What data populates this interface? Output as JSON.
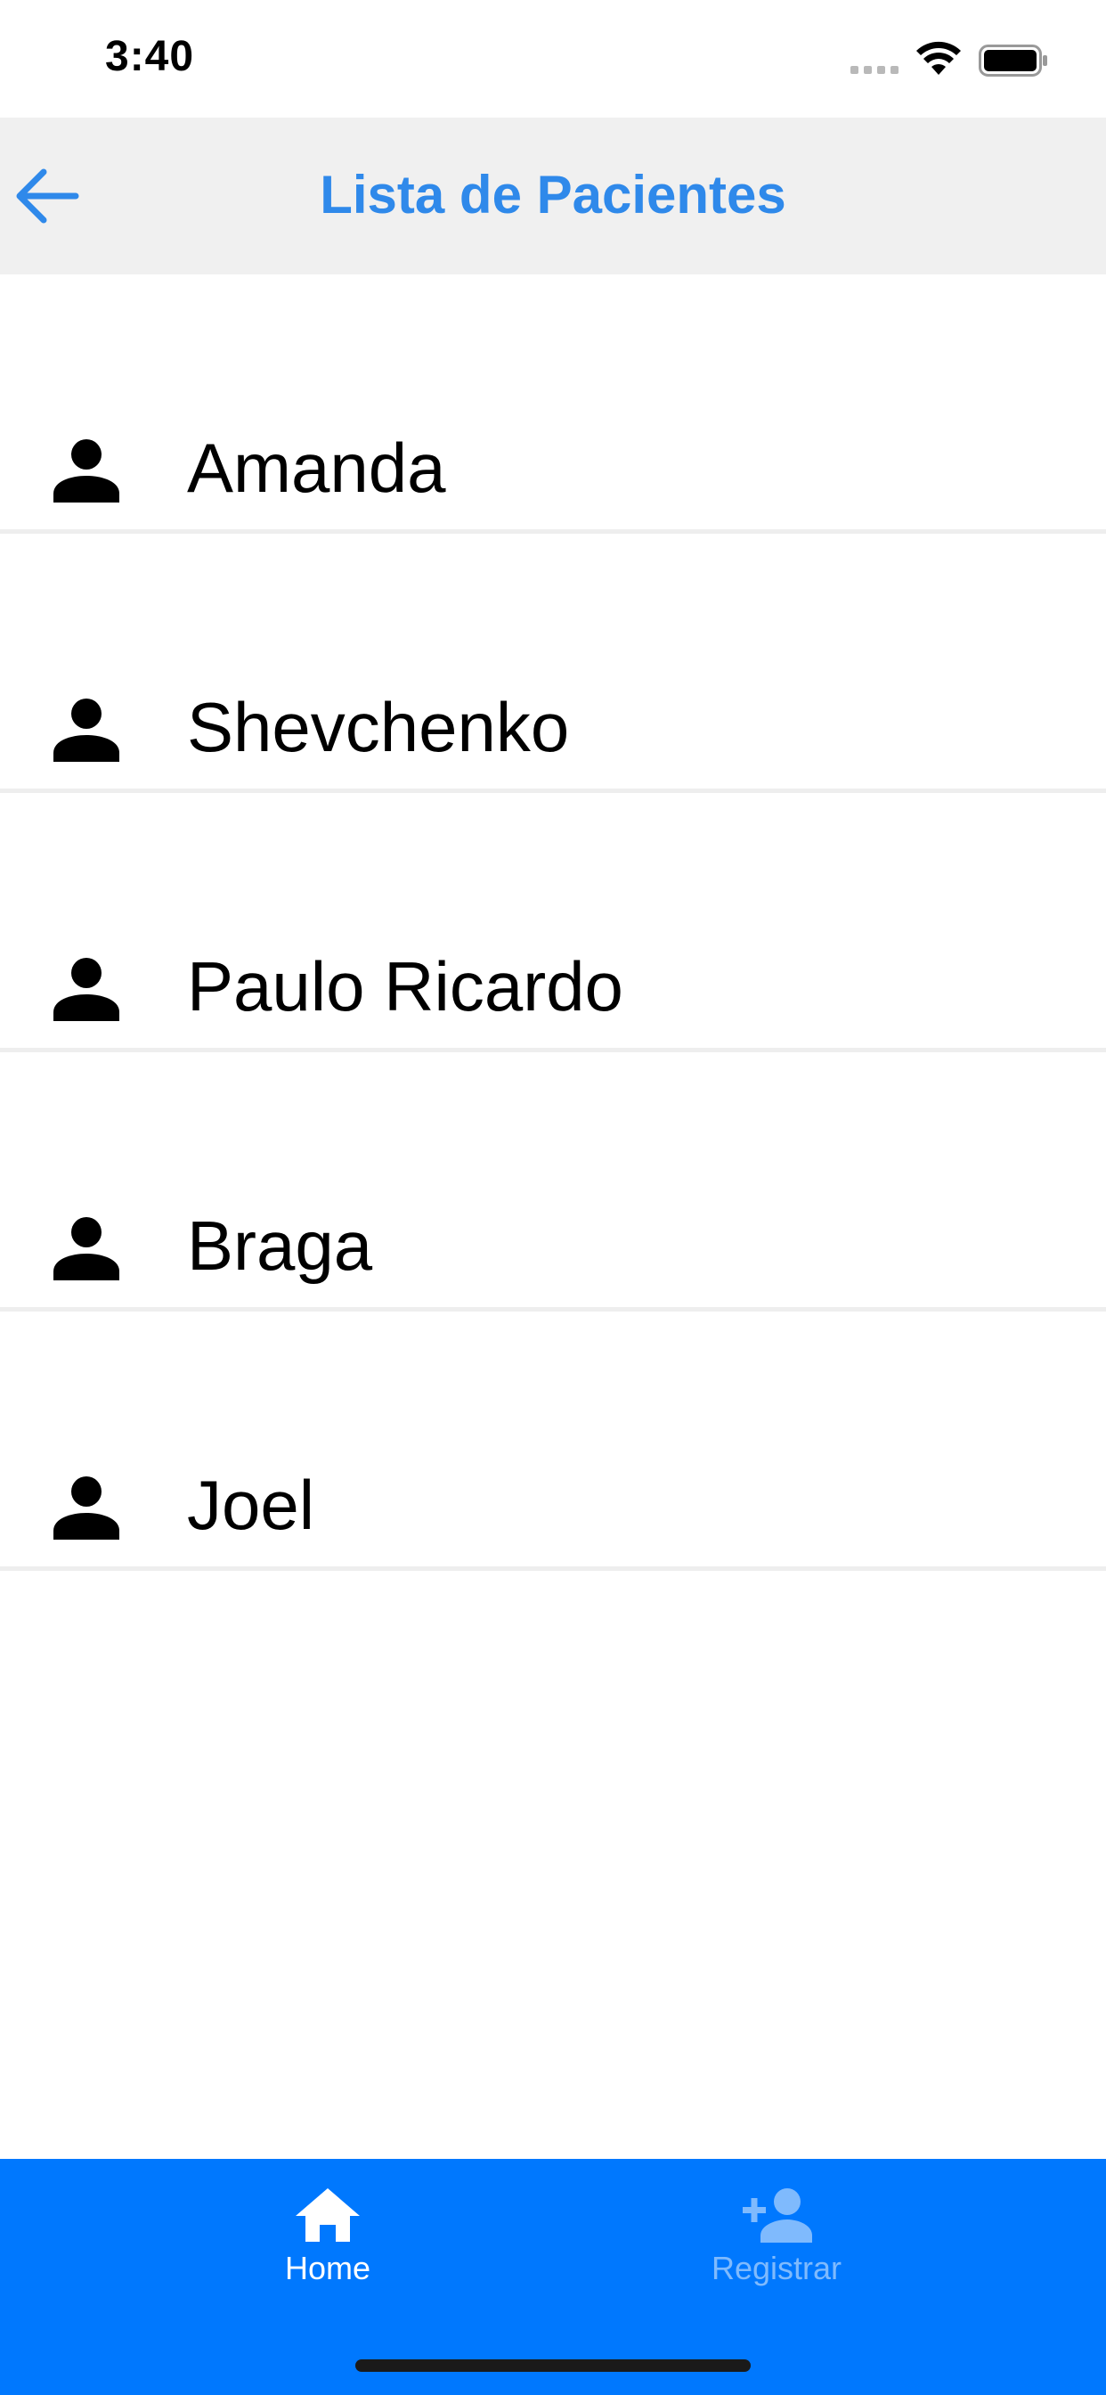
{
  "status_bar": {
    "time": "3:40"
  },
  "header": {
    "title": "Lista de Pacientes",
    "back_icon": "arrow-left-icon",
    "accent_color": "#2f89ea",
    "background_color": "#f0f0f0"
  },
  "patients": [
    {
      "name": "Amanda",
      "icon": "person-icon"
    },
    {
      "name": "Shevchenko",
      "icon": "person-icon"
    },
    {
      "name": "Paulo Ricardo",
      "icon": "person-icon"
    },
    {
      "name": "Braga",
      "icon": "person-icon"
    },
    {
      "name": "Joel",
      "icon": "person-icon"
    }
  ],
  "tab_bar": {
    "background_color": "#0078fe",
    "tabs": [
      {
        "label": "Home",
        "icon": "home-icon",
        "active": true
      },
      {
        "label": "Registrar",
        "icon": "add-user-icon",
        "active": false
      }
    ]
  }
}
